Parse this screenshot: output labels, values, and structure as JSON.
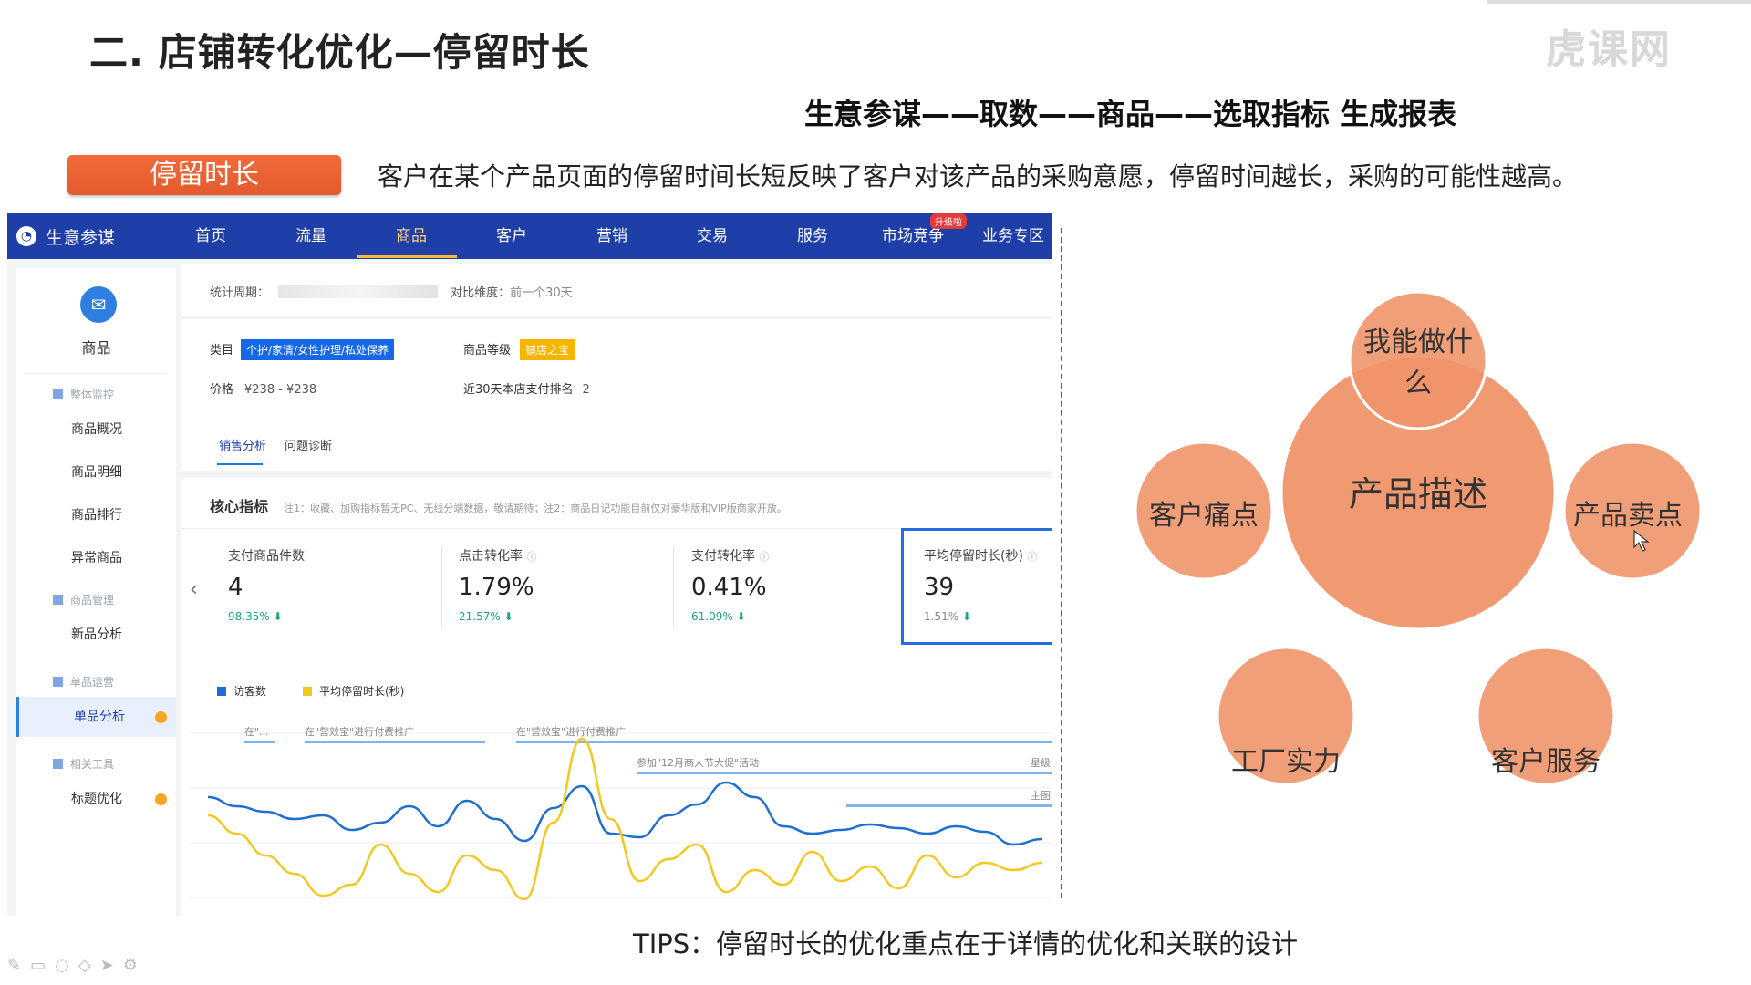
{
  "slide": {
    "title": "二. 店铺转化优化—停留时长",
    "watermark": "虎课网",
    "path": "生意参谋——取数——商品——选取指标 生成报表",
    "tag": "停留时长",
    "description": "客户在某个产品页面的停留时间长短反映了客户对该产品的采购意愿，停留时间越长，采购的可能性越高。",
    "tips": "TIPS：停留时长的优化重点在于详情的优化和关联的设计"
  },
  "app": {
    "brand": "生意参谋",
    "nav": [
      "首页",
      "流量",
      "商品",
      "客户",
      "营销",
      "交易",
      "服务",
      "市场竞争",
      "业务专区"
    ],
    "nav_active": "商品",
    "nav_badge": "升级啦",
    "sidebar": {
      "title": "商品",
      "group_overview": "整体监控",
      "items_1": [
        "商品概况",
        "商品明细",
        "商品排行",
        "异常商品"
      ],
      "group_manage": "商品管理",
      "items_2": [
        "新品分析"
      ],
      "group_single": "单品运营",
      "active_item": "单品分析",
      "group_tools": "相关工具",
      "items_4": [
        "标题优化"
      ]
    },
    "period": {
      "label": "统计周期：",
      "compare_label": "对比维度：",
      "compare_value": "前一个30天"
    },
    "product": {
      "category_label": "类目",
      "category_value": "个护/家清/女性护理/私处保养",
      "grade_label": "商品等级",
      "grade_value": "镇店之宝",
      "price_label": "价格",
      "price_value": "¥238 - ¥238",
      "rank_label": "近30天本店支付排名",
      "rank_value": "2"
    },
    "tabs": [
      "销售分析",
      "问题诊断"
    ],
    "core": {
      "title": "核心指标",
      "note": "注1：收藏、加购指标暂无PC、无线分端数据，敬请期待；注2：商品日记功能目前仅对豪华版和VIP版商家开放。"
    },
    "metrics": [
      {
        "label": "支付商品件数",
        "value": "4",
        "delta": "98.35%"
      },
      {
        "label": "点击转化率",
        "value": "1.79%",
        "delta": "21.57%"
      },
      {
        "label": "支付转化率",
        "value": "0.41%",
        "delta": "61.09%"
      },
      {
        "label": "平均停留时长(秒)",
        "value": "39",
        "delta": "1.51%"
      }
    ],
    "legend": {
      "series_1": "访客数",
      "series_2": "平均停留时长(秒)"
    },
    "annotations": {
      "a1": "在\"...",
      "a2": "在\"营效宝\"进行付费推广",
      "a3": "在\"营效宝\"进行付费推广",
      "a4": "参加\"12月商人节大促\"活动",
      "a5": "星级",
      "a6": "主图"
    }
  },
  "chart_data": {
    "type": "line",
    "grid": true,
    "x": [
      0,
      1,
      2,
      3,
      4,
      5,
      6,
      7,
      8,
      9,
      10,
      11,
      12,
      13,
      14,
      15,
      16,
      17,
      18,
      19,
      20,
      21,
      22,
      23,
      24,
      25,
      26,
      27,
      28,
      29
    ],
    "series": [
      {
        "name": "访客数",
        "color": "#1f6fd0",
        "values": [
          60,
          55,
          52,
          48,
          50,
          42,
          46,
          55,
          44,
          58,
          48,
          36,
          54,
          66,
          40,
          38,
          50,
          56,
          68,
          60,
          44,
          40,
          42,
          45,
          43,
          40,
          44,
          41,
          34,
          37
        ]
      },
      {
        "name": "平均停留时长(秒)",
        "color": "#f2c81f",
        "values": [
          50,
          40,
          28,
          18,
          6,
          12,
          34,
          18,
          8,
          28,
          20,
          4,
          46,
          92,
          48,
          14,
          26,
          34,
          8,
          20,
          12,
          30,
          14,
          22,
          10,
          28,
          16,
          24,
          20,
          24
        ]
      }
    ],
    "ylim": [
      0,
      100
    ]
  },
  "venn": {
    "center": "产品描述",
    "top_line1": "我能做什",
    "top_line2": "么",
    "left": "客户痛点",
    "right": "产品卖点",
    "bottom_left": "工厂实力",
    "bottom_right": "客户服务",
    "fill": "#f0956a",
    "stroke": "#ffffff"
  }
}
